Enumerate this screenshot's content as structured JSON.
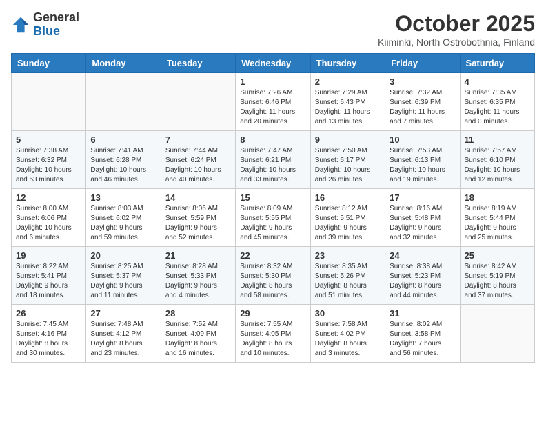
{
  "header": {
    "logo_general": "General",
    "logo_blue": "Blue",
    "title": "October 2025",
    "subtitle": "Kiiminki, North Ostrobothnia, Finland"
  },
  "weekdays": [
    "Sunday",
    "Monday",
    "Tuesday",
    "Wednesday",
    "Thursday",
    "Friday",
    "Saturday"
  ],
  "weeks": [
    [
      {
        "day": "",
        "info": ""
      },
      {
        "day": "",
        "info": ""
      },
      {
        "day": "",
        "info": ""
      },
      {
        "day": "1",
        "info": "Sunrise: 7:26 AM\nSunset: 6:46 PM\nDaylight: 11 hours\nand 20 minutes."
      },
      {
        "day": "2",
        "info": "Sunrise: 7:29 AM\nSunset: 6:43 PM\nDaylight: 11 hours\nand 13 minutes."
      },
      {
        "day": "3",
        "info": "Sunrise: 7:32 AM\nSunset: 6:39 PM\nDaylight: 11 hours\nand 7 minutes."
      },
      {
        "day": "4",
        "info": "Sunrise: 7:35 AM\nSunset: 6:35 PM\nDaylight: 11 hours\nand 0 minutes."
      }
    ],
    [
      {
        "day": "5",
        "info": "Sunrise: 7:38 AM\nSunset: 6:32 PM\nDaylight: 10 hours\nand 53 minutes."
      },
      {
        "day": "6",
        "info": "Sunrise: 7:41 AM\nSunset: 6:28 PM\nDaylight: 10 hours\nand 46 minutes."
      },
      {
        "day": "7",
        "info": "Sunrise: 7:44 AM\nSunset: 6:24 PM\nDaylight: 10 hours\nand 40 minutes."
      },
      {
        "day": "8",
        "info": "Sunrise: 7:47 AM\nSunset: 6:21 PM\nDaylight: 10 hours\nand 33 minutes."
      },
      {
        "day": "9",
        "info": "Sunrise: 7:50 AM\nSunset: 6:17 PM\nDaylight: 10 hours\nand 26 minutes."
      },
      {
        "day": "10",
        "info": "Sunrise: 7:53 AM\nSunset: 6:13 PM\nDaylight: 10 hours\nand 19 minutes."
      },
      {
        "day": "11",
        "info": "Sunrise: 7:57 AM\nSunset: 6:10 PM\nDaylight: 10 hours\nand 12 minutes."
      }
    ],
    [
      {
        "day": "12",
        "info": "Sunrise: 8:00 AM\nSunset: 6:06 PM\nDaylight: 10 hours\nand 6 minutes."
      },
      {
        "day": "13",
        "info": "Sunrise: 8:03 AM\nSunset: 6:02 PM\nDaylight: 9 hours\nand 59 minutes."
      },
      {
        "day": "14",
        "info": "Sunrise: 8:06 AM\nSunset: 5:59 PM\nDaylight: 9 hours\nand 52 minutes."
      },
      {
        "day": "15",
        "info": "Sunrise: 8:09 AM\nSunset: 5:55 PM\nDaylight: 9 hours\nand 45 minutes."
      },
      {
        "day": "16",
        "info": "Sunrise: 8:12 AM\nSunset: 5:51 PM\nDaylight: 9 hours\nand 39 minutes."
      },
      {
        "day": "17",
        "info": "Sunrise: 8:16 AM\nSunset: 5:48 PM\nDaylight: 9 hours\nand 32 minutes."
      },
      {
        "day": "18",
        "info": "Sunrise: 8:19 AM\nSunset: 5:44 PM\nDaylight: 9 hours\nand 25 minutes."
      }
    ],
    [
      {
        "day": "19",
        "info": "Sunrise: 8:22 AM\nSunset: 5:41 PM\nDaylight: 9 hours\nand 18 minutes."
      },
      {
        "day": "20",
        "info": "Sunrise: 8:25 AM\nSunset: 5:37 PM\nDaylight: 9 hours\nand 11 minutes."
      },
      {
        "day": "21",
        "info": "Sunrise: 8:28 AM\nSunset: 5:33 PM\nDaylight: 9 hours\nand 4 minutes."
      },
      {
        "day": "22",
        "info": "Sunrise: 8:32 AM\nSunset: 5:30 PM\nDaylight: 8 hours\nand 58 minutes."
      },
      {
        "day": "23",
        "info": "Sunrise: 8:35 AM\nSunset: 5:26 PM\nDaylight: 8 hours\nand 51 minutes."
      },
      {
        "day": "24",
        "info": "Sunrise: 8:38 AM\nSunset: 5:23 PM\nDaylight: 8 hours\nand 44 minutes."
      },
      {
        "day": "25",
        "info": "Sunrise: 8:42 AM\nSunset: 5:19 PM\nDaylight: 8 hours\nand 37 minutes."
      }
    ],
    [
      {
        "day": "26",
        "info": "Sunrise: 7:45 AM\nSunset: 4:16 PM\nDaylight: 8 hours\nand 30 minutes."
      },
      {
        "day": "27",
        "info": "Sunrise: 7:48 AM\nSunset: 4:12 PM\nDaylight: 8 hours\nand 23 minutes."
      },
      {
        "day": "28",
        "info": "Sunrise: 7:52 AM\nSunset: 4:09 PM\nDaylight: 8 hours\nand 16 minutes."
      },
      {
        "day": "29",
        "info": "Sunrise: 7:55 AM\nSunset: 4:05 PM\nDaylight: 8 hours\nand 10 minutes."
      },
      {
        "day": "30",
        "info": "Sunrise: 7:58 AM\nSunset: 4:02 PM\nDaylight: 8 hours\nand 3 minutes."
      },
      {
        "day": "31",
        "info": "Sunrise: 8:02 AM\nSunset: 3:58 PM\nDaylight: 7 hours\nand 56 minutes."
      },
      {
        "day": "",
        "info": ""
      }
    ]
  ]
}
